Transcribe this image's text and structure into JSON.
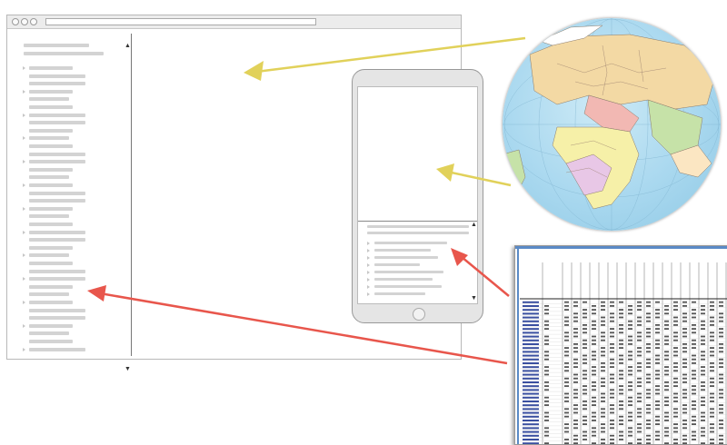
{
  "diagram": {
    "arrow_colors": {
      "map_arrows": "#e1d15a",
      "table_arrows": "#e8564c"
    },
    "globe": {
      "icon": "world-political-map-globe",
      "land_colors": [
        "#f3d9a4",
        "#f2b8b3",
        "#c6e2a8",
        "#f6f0a8",
        "#e8c7e6",
        "#fbe6c2"
      ]
    },
    "data_table": {
      "icon": "spreadsheet-data-table"
    }
  }
}
